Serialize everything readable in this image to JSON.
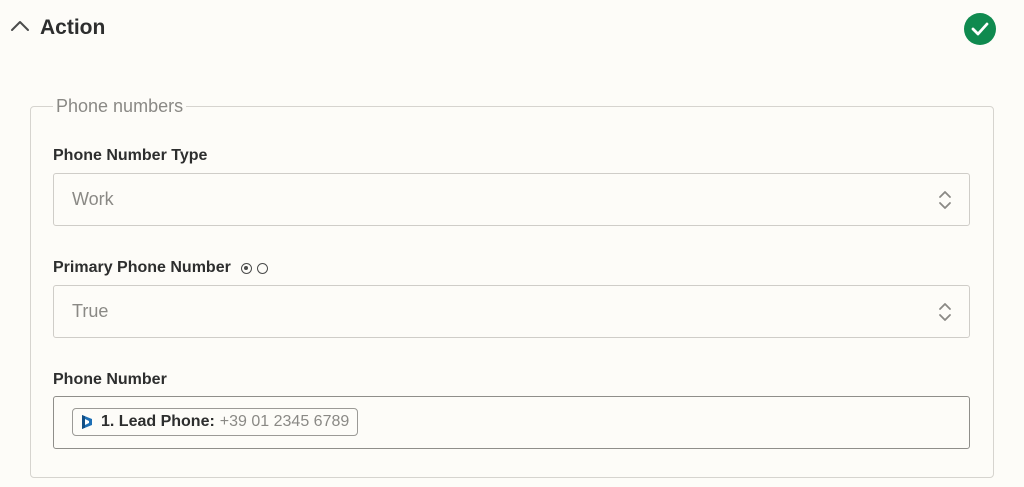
{
  "section": {
    "title": "Action",
    "collapse_icon": "chevron-up-icon",
    "status_icon": "check-circle-icon",
    "status_color": "#0f8a4f"
  },
  "group": {
    "legend": "Phone numbers"
  },
  "fields": {
    "phone_number_type": {
      "label": "Phone Number Type",
      "value": "Work"
    },
    "primary_phone_number": {
      "label": "Primary Phone Number",
      "value": "True",
      "hint_icon": "radio-icon"
    },
    "phone_number": {
      "label": "Phone Number",
      "mapped_pill": {
        "step": "1. Lead Phone:",
        "value": "+39 01 2345 6789",
        "app_icon": "app-logo-icon"
      }
    }
  },
  "colors": {
    "background": "#fdfcf8",
    "text": "#2d2e2e",
    "muted_text": "#8a8985",
    "border": "#cfcdc8",
    "app_logo": "#1d6fb5"
  }
}
